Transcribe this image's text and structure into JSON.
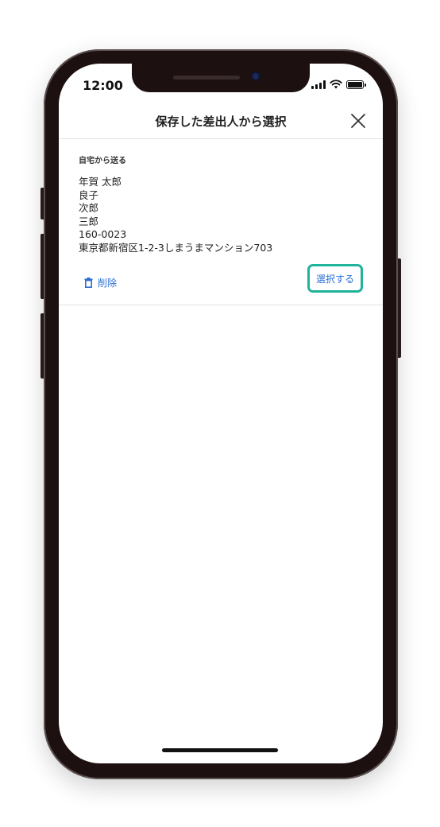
{
  "status_bar": {
    "time": "12:00"
  },
  "header": {
    "title": "保存した差出人から選択",
    "close_icon": "close-icon"
  },
  "sender_card": {
    "label": "自宅から送る",
    "address_lines": [
      "年賀 太郎",
      "良子",
      "次郎",
      "三郎",
      "160-0023",
      "東京都新宿区1-2-3しまうまマンション703"
    ],
    "delete_label": "削除",
    "delete_icon": "trash-icon",
    "select_label": "選択する"
  },
  "colors": {
    "link_blue": "#2a6fd6",
    "highlight_teal": "#1fb39a",
    "phone_frame": "#1d1010"
  }
}
